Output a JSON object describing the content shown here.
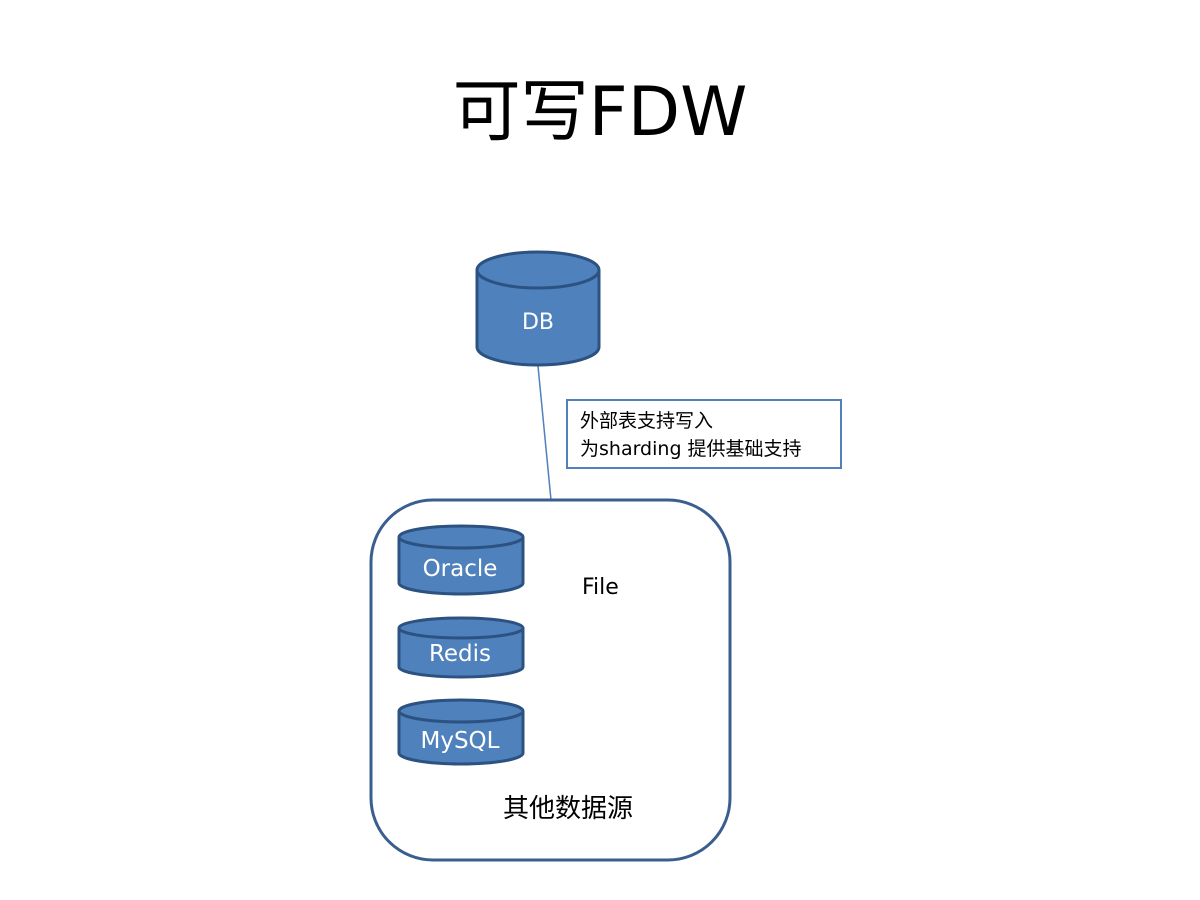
{
  "title": "可写FDW",
  "diagram": {
    "main_db_label": "DB",
    "callout_lines": [
      "外部表支持写入",
      "为sharding 提供基础支持"
    ],
    "sources": {
      "group_label": "其他数据源",
      "file_label": "File",
      "databases": [
        "Oracle",
        "Redis",
        "MySQL"
      ]
    }
  },
  "colors": {
    "cylinder_fill": "#4f81bd",
    "cylinder_stroke": "#2c5282",
    "container_stroke": "#3a5f8f",
    "callout_border": "#4f81bd"
  }
}
